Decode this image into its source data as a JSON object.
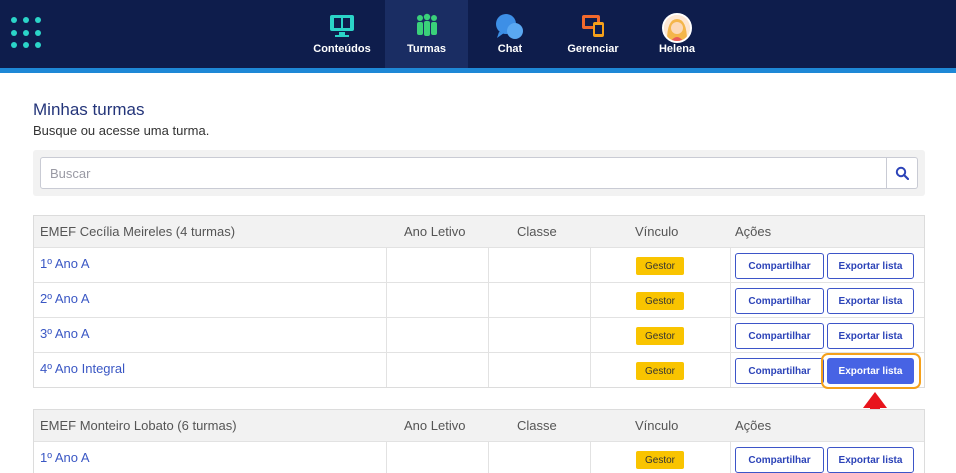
{
  "nav": {
    "items": [
      {
        "label": "Conteúdos",
        "icon": "monitor-book-icon"
      },
      {
        "label": "Turmas",
        "icon": "people-group-icon",
        "active": true
      },
      {
        "label": "Chat",
        "icon": "chat-bubbles-icon"
      },
      {
        "label": "Gerenciar",
        "icon": "devices-settings-icon"
      },
      {
        "label": "Helena",
        "icon": "user-avatar-icon"
      }
    ]
  },
  "page": {
    "title": "Minhas turmas",
    "subtitle": "Busque ou acesse uma turma."
  },
  "search": {
    "placeholder": "Buscar",
    "value": ""
  },
  "columns": {
    "ano_letivo": "Ano Letivo",
    "classe": "Classe",
    "vinculo": "Vínculo",
    "acoes": "Ações"
  },
  "schools": [
    {
      "name": "EMEF Cecília Meireles (4 turmas)",
      "rows": [
        {
          "name": "1º Ano A",
          "ano_letivo": "",
          "classe": "",
          "vinculo": "Gestor",
          "share": "Compartilhar",
          "export": "Exportar lista"
        },
        {
          "name": "2º Ano A",
          "ano_letivo": "",
          "classe": "",
          "vinculo": "Gestor",
          "share": "Compartilhar",
          "export": "Exportar lista"
        },
        {
          "name": "3º Ano A",
          "ano_letivo": "",
          "classe": "",
          "vinculo": "Gestor",
          "share": "Compartilhar",
          "export": "Exportar lista"
        },
        {
          "name": "4º Ano Integral",
          "ano_letivo": "",
          "classe": "",
          "vinculo": "Gestor",
          "share": "Compartilhar",
          "export": "Exportar lista"
        }
      ]
    },
    {
      "name": "EMEF Monteiro Lobato (6 turmas)",
      "rows": [
        {
          "name": "1º Ano A",
          "ano_letivo": "",
          "classe": "",
          "vinculo": "Gestor",
          "share": "Compartilhar",
          "export": "Exportar lista"
        }
      ]
    }
  ],
  "colors": {
    "topbar": "#0e1d4c",
    "accent": "#4763e4",
    "badge": "#f9c400",
    "highlight": "#f5a01a",
    "arrow": "#e8141c"
  }
}
